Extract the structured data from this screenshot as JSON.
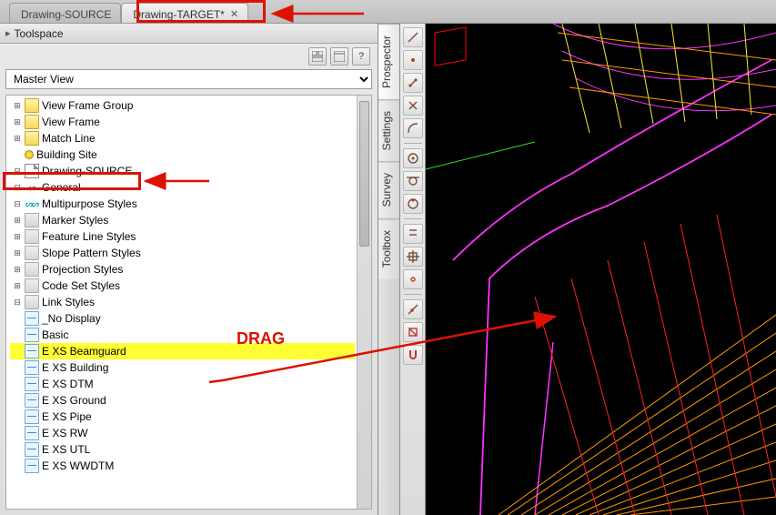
{
  "tabs": {
    "source": "Drawing-SOURCE",
    "target": "Drawing-TARGET*"
  },
  "toolspace": {
    "title": "Toolspace"
  },
  "view_selector": {
    "selected": "Master View"
  },
  "side_tabs": {
    "prospector": "Prospector",
    "settings": "Settings",
    "survey": "Survey",
    "toolbox": "Toolbox"
  },
  "tree": {
    "view_frame_group": "View Frame Group",
    "view_frame": "View Frame",
    "match_line": "Match Line",
    "building_site": "Building Site",
    "drawing_source": "Drawing-SOURCE",
    "general": "General",
    "multipurpose_styles": "Multipurpose Styles",
    "marker_styles": "Marker Styles",
    "feature_line_styles": "Feature Line Styles",
    "slope_pattern_styles": "Slope Pattern Styles",
    "projection_styles": "Projection Styles",
    "code_set_styles": "Code Set Styles",
    "link_styles": "Link Styles",
    "ls": {
      "no_display": "_No Display",
      "basic": "Basic",
      "e_xs_beamguard": "E XS Beamguard",
      "e_xs_building": "E XS Building",
      "e_xs_dtm": "E XS DTM",
      "e_xs_ground": "E XS Ground",
      "e_xs_pipe": "E XS Pipe",
      "e_xs_rw": "E XS RW",
      "e_xs_utl": "E XS UTL",
      "e_xs_wwdtm": "E XS WWDTM"
    }
  },
  "annotations": {
    "drag": "DRAG"
  },
  "help_icon": "?"
}
